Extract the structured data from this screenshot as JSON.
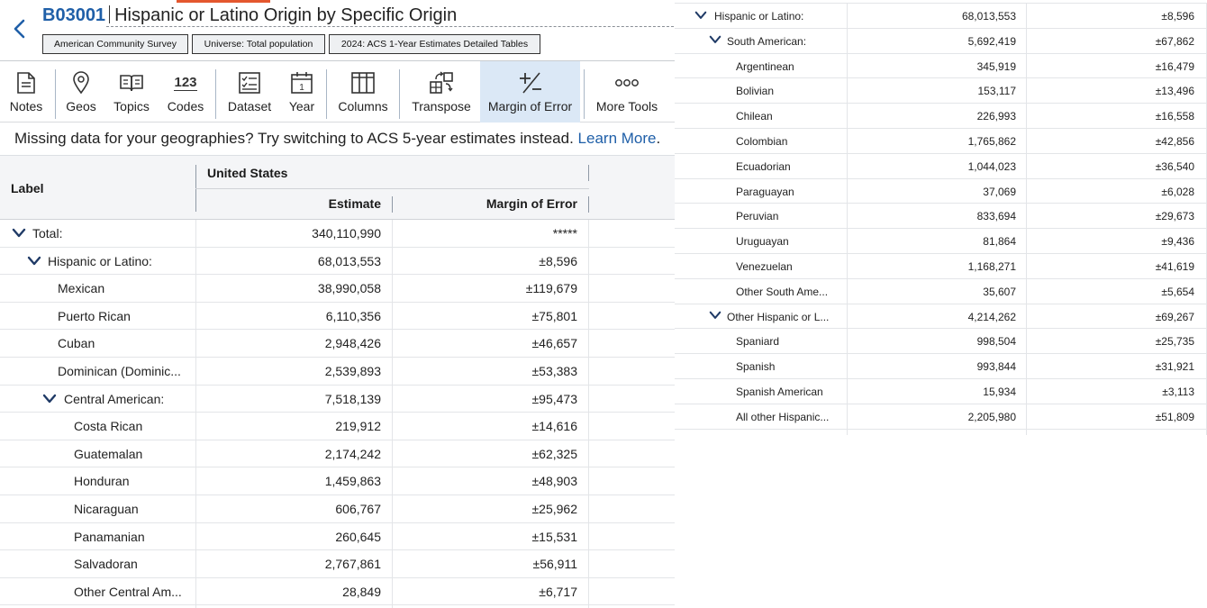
{
  "header": {
    "table_id": "B03001",
    "table_title": "Hispanic or Latino Origin by Specific Origin",
    "chips": [
      "American Community Survey",
      "Universe: Total population",
      "2024: ACS 1-Year Estimates Detailed Tables"
    ]
  },
  "toolbar": {
    "items": [
      {
        "label": "Notes",
        "icon": "notes-icon"
      },
      {
        "label": "Geos",
        "icon": "map-pin-icon"
      },
      {
        "label": "Topics",
        "icon": "book-icon"
      },
      {
        "label": "Codes",
        "icon": "codes-icon",
        "glyph": "123"
      },
      {
        "label": "Dataset",
        "icon": "checklist-icon"
      },
      {
        "label": "Year",
        "icon": "calendar-icon",
        "glyph": "1"
      },
      {
        "label": "Columns",
        "icon": "columns-icon"
      },
      {
        "label": "Transpose",
        "icon": "transpose-icon"
      },
      {
        "label": "Margin of Error",
        "icon": "plus-minus-icon",
        "active": true
      },
      {
        "label": "More Tools",
        "icon": "more-dots-icon"
      }
    ]
  },
  "notice": {
    "text": "Missing data for your geographies? Try switching to ACS 5-year estimates instead.",
    "link": "Learn More",
    "suffix": "."
  },
  "table": {
    "label_header": "Label",
    "geo_header": "United States",
    "estimate_header": "Estimate",
    "moe_header": "Margin of Error",
    "left_rows": [
      {
        "label": "Total:",
        "estimate": "340,110,990",
        "moe": "*****",
        "level": 0,
        "expandable": true
      },
      {
        "label": "Hispanic or Latino:",
        "estimate": "68,013,553",
        "moe": "±8,596",
        "level": 1,
        "expandable": true
      },
      {
        "label": "Mexican",
        "estimate": "38,990,058",
        "moe": "±119,679",
        "level": 2
      },
      {
        "label": "Puerto Rican",
        "estimate": "6,110,356",
        "moe": "±75,801",
        "level": 2
      },
      {
        "label": "Cuban",
        "estimate": "2,948,426",
        "moe": "±46,657",
        "level": 2
      },
      {
        "label": "Dominican (Dominic...",
        "estimate": "2,539,893",
        "moe": "±53,383",
        "level": 2
      },
      {
        "label": "Central American:",
        "estimate": "7,518,139",
        "moe": "±95,473",
        "level": 2,
        "expandable": true
      },
      {
        "label": "Costa Rican",
        "estimate": "219,912",
        "moe": "±14,616",
        "level": 3
      },
      {
        "label": "Guatemalan",
        "estimate": "2,174,242",
        "moe": "±62,325",
        "level": 3
      },
      {
        "label": "Honduran",
        "estimate": "1,459,863",
        "moe": "±48,903",
        "level": 3
      },
      {
        "label": "Nicaraguan",
        "estimate": "606,767",
        "moe": "±25,962",
        "level": 3
      },
      {
        "label": "Panamanian",
        "estimate": "260,645",
        "moe": "±15,531",
        "level": 3
      },
      {
        "label": "Salvadoran",
        "estimate": "2,767,861",
        "moe": "±56,911",
        "level": 3
      },
      {
        "label": "Other Central Am...",
        "estimate": "28,849",
        "moe": "±6,717",
        "level": 3
      }
    ],
    "right_rows": [
      {
        "label": "Hispanic or Latino:",
        "estimate": "68,013,553",
        "moe": "±8,596",
        "level": 1,
        "expandable": true
      },
      {
        "label": "South American:",
        "estimate": "5,692,419",
        "moe": "±67,862",
        "level": 2,
        "expandable": true
      },
      {
        "label": "Argentinean",
        "estimate": "345,919",
        "moe": "±16,479",
        "level": 3
      },
      {
        "label": "Bolivian",
        "estimate": "153,117",
        "moe": "±13,496",
        "level": 3
      },
      {
        "label": "Chilean",
        "estimate": "226,993",
        "moe": "±16,558",
        "level": 3
      },
      {
        "label": "Colombian",
        "estimate": "1,765,862",
        "moe": "±42,856",
        "level": 3
      },
      {
        "label": "Ecuadorian",
        "estimate": "1,044,023",
        "moe": "±36,540",
        "level": 3
      },
      {
        "label": "Paraguayan",
        "estimate": "37,069",
        "moe": "±6,028",
        "level": 3
      },
      {
        "label": "Peruvian",
        "estimate": "833,694",
        "moe": "±29,673",
        "level": 3
      },
      {
        "label": "Uruguayan",
        "estimate": "81,864",
        "moe": "±9,436",
        "level": 3
      },
      {
        "label": "Venezuelan",
        "estimate": "1,168,271",
        "moe": "±41,619",
        "level": 3
      },
      {
        "label": "Other South Ame...",
        "estimate": "35,607",
        "moe": "±5,654",
        "level": 3
      },
      {
        "label": "Other Hispanic or L...",
        "estimate": "4,214,262",
        "moe": "±69,267",
        "level": 2,
        "expandable": true
      },
      {
        "label": "Spaniard",
        "estimate": "998,504",
        "moe": "±25,735",
        "level": 3
      },
      {
        "label": "Spanish",
        "estimate": "993,844",
        "moe": "±31,921",
        "level": 3
      },
      {
        "label": "Spanish American",
        "estimate": "15,934",
        "moe": "±3,113",
        "level": 3
      },
      {
        "label": "All other Hispanic...",
        "estimate": "2,205,980",
        "moe": "±51,809",
        "level": 3
      }
    ]
  },
  "colors": {
    "link": "#1f5fa8",
    "accent": "#e4572e",
    "active_tool": "#dbe8f6"
  }
}
